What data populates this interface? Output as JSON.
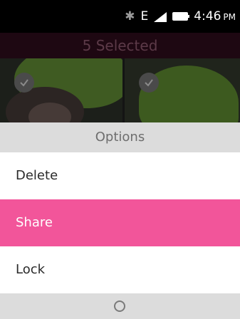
{
  "status_bar": {
    "network_type": "E",
    "time": "4:46",
    "ampm": "PM"
  },
  "header": {
    "title": "5 Selected"
  },
  "options_menu": {
    "title": "Options",
    "items": [
      {
        "label": "Delete"
      },
      {
        "label": "Share",
        "selected": true
      },
      {
        "label": "Lock"
      }
    ]
  },
  "icons": {
    "bluetooth": "bluetooth-icon",
    "signal": "signal-icon",
    "battery": "battery-icon",
    "check": "check-icon",
    "center_softkey": "circle-icon"
  },
  "colors": {
    "highlight": "#f2559a",
    "title_bar": "#dcdcdc"
  }
}
